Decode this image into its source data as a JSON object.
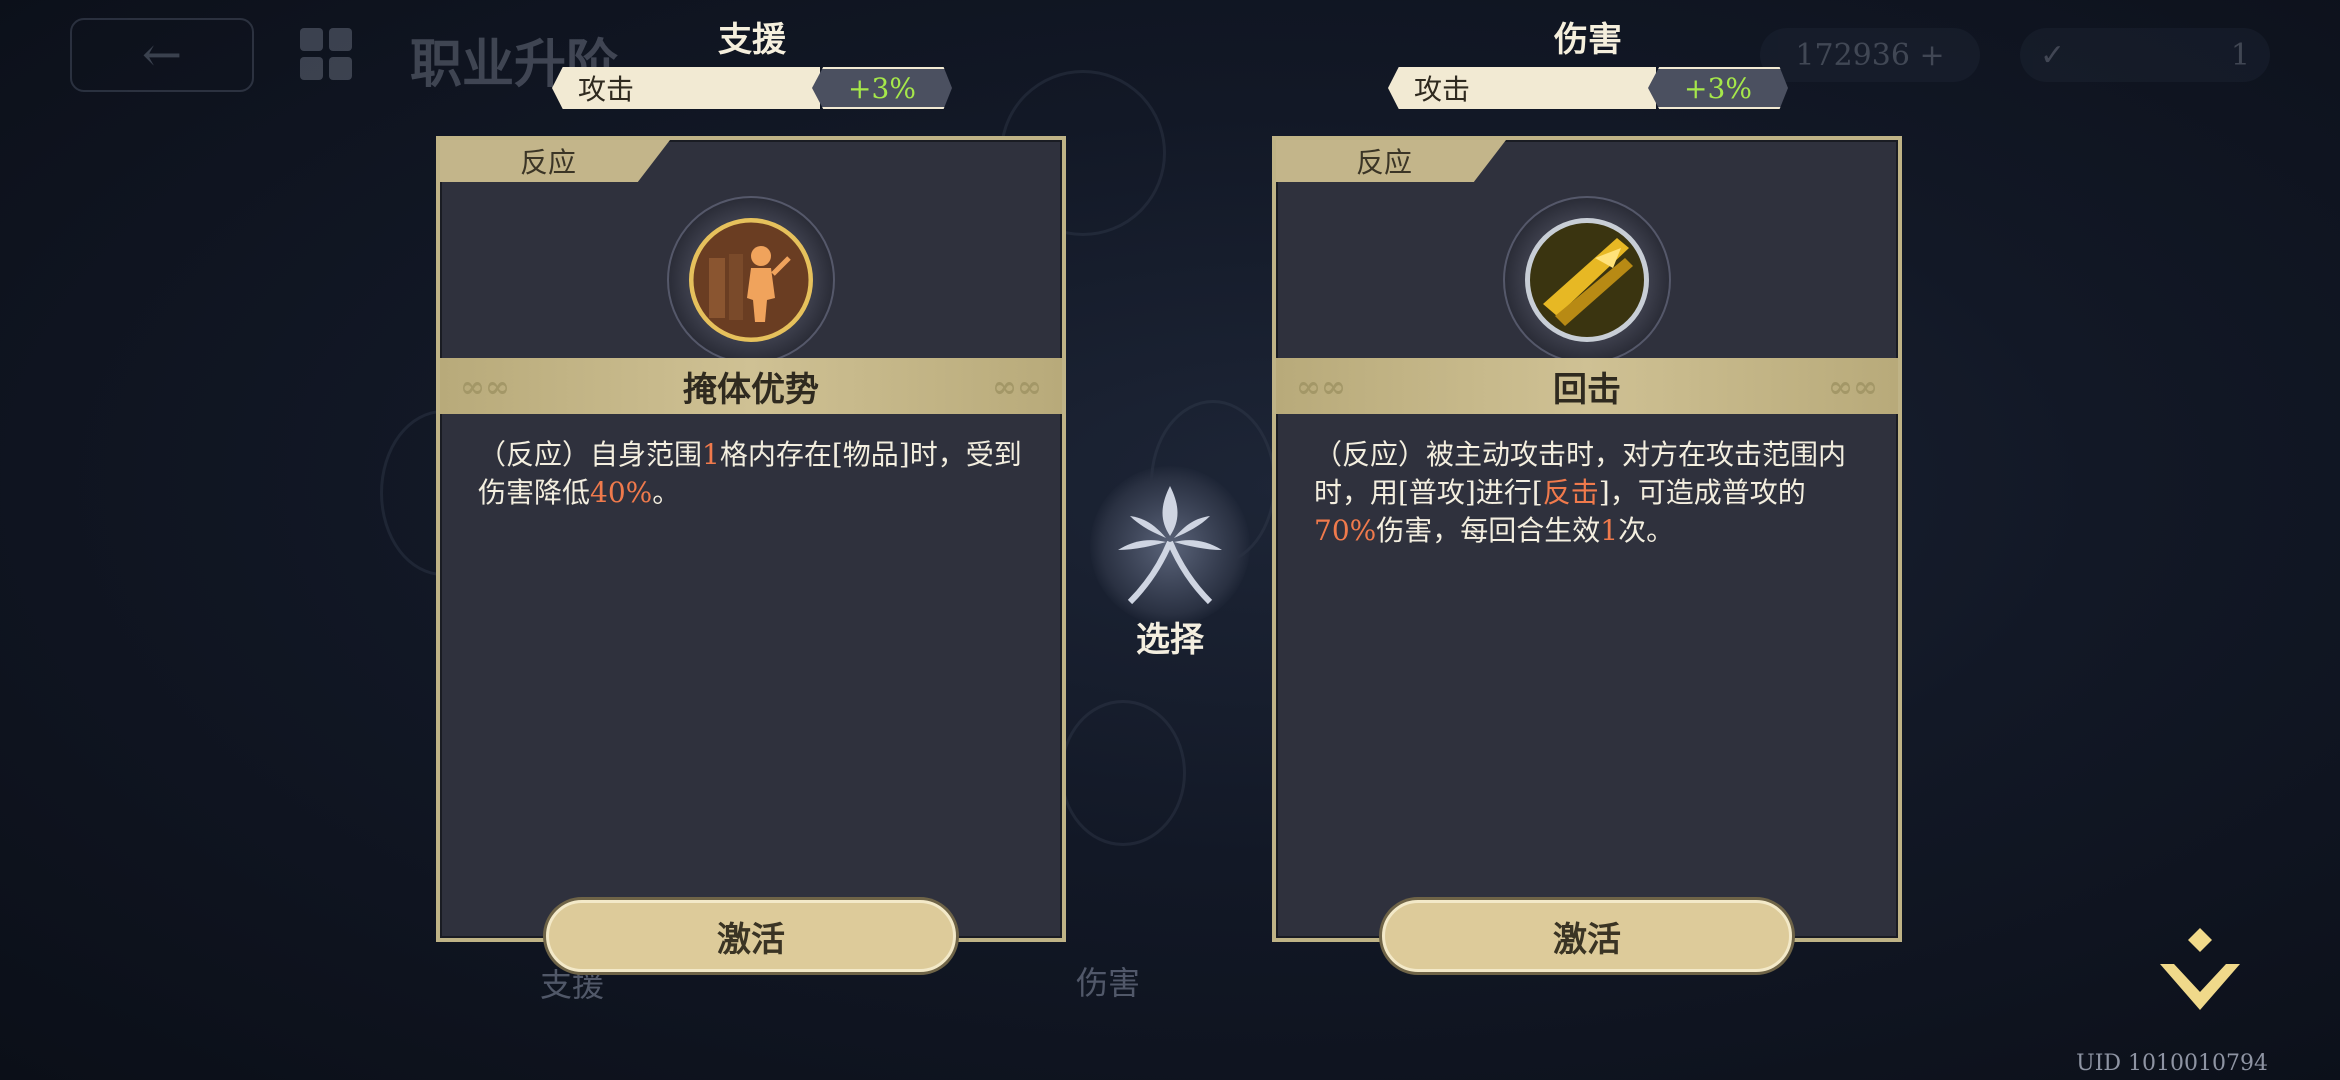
{
  "background": {
    "page_title": "职业升阶",
    "currency_value": "172936",
    "ticket_value": "1",
    "tab_left": "支援",
    "tab_right": "伤害"
  },
  "columns": [
    {
      "title": "支援",
      "stat_label": "攻击",
      "stat_value": "+3%"
    },
    {
      "title": "伤害",
      "stat_label": "攻击",
      "stat_value": "+3%"
    }
  ],
  "cards": [
    {
      "tag": "反应",
      "skill_name": "掩体优势",
      "icon": "cover-advantage-icon",
      "desc_parts": [
        "（反应）自身范围",
        "1",
        "格内存在[物品]时，受到伤害降低",
        "40%",
        "。"
      ],
      "button_label": "激活"
    },
    {
      "tag": "反应",
      "skill_name": "回击",
      "icon": "counterattack-icon",
      "desc_parts": [
        "（反应）被主动攻击时，对方在攻击范围内时，用[普攻]进行[",
        "反击",
        "]，可造成普攻的",
        "70%",
        "伤害，每回合生效",
        "1",
        "次。"
      ],
      "button_label": "激活"
    }
  ],
  "center": {
    "label": "选择"
  },
  "footer": {
    "uid": "UID 1010010794"
  },
  "colors": {
    "accent_gold": "#ddcb9a",
    "highlight": "#f07a4c",
    "stat_green": "#a6e84a"
  }
}
